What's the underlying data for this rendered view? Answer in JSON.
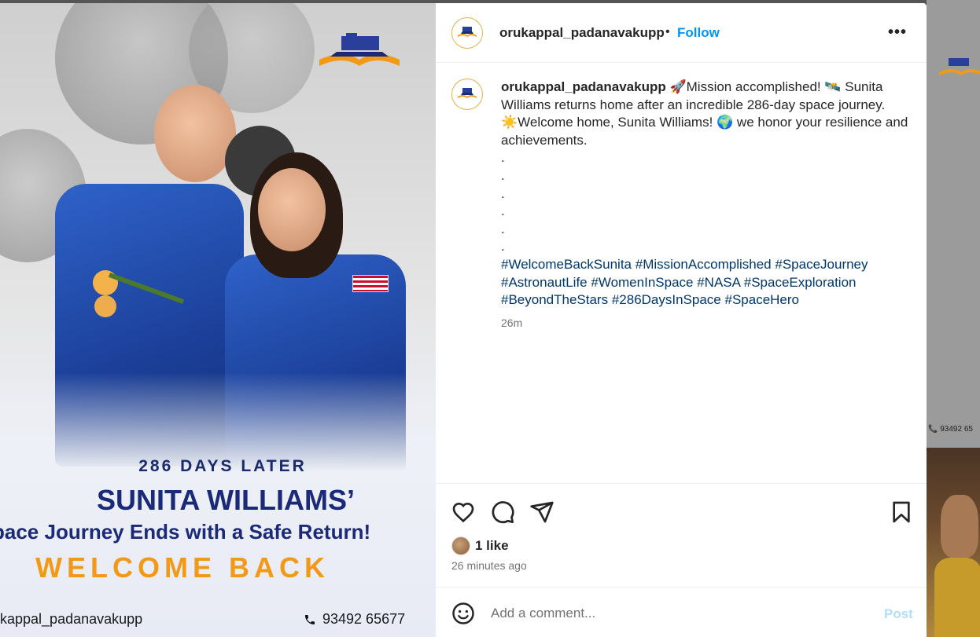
{
  "post": {
    "username": "orukappal_padanavakupp",
    "follow_label": "Follow",
    "separator": "•",
    "more_label": "•••",
    "caption": {
      "username": "orukappal_padanavakupp",
      "line1": "🚀Mission accomplished! 🛰️ Sunita Williams returns home after an incredible 286-day space journey.",
      "line2": "☀️Welcome home, Sunita Williams! 🌍 we honor your resilience and achievements.",
      "dots": [
        ".",
        ".",
        ".",
        ".",
        ".",
        "."
      ],
      "hashtags": [
        "#WelcomeBackSunita",
        "#MissionAccomplished",
        "#SpaceJourney",
        "#AstronautLife",
        "#WomenInSpace",
        "#NASA",
        "#SpaceExploration",
        "#BeyondTheStars",
        "#286DaysInSpace",
        "#SpaceHero"
      ],
      "time": "26m"
    },
    "likes": "1 like",
    "posted_ago": "26 minutes ago",
    "comment": {
      "placeholder": "Add a comment...",
      "post_label": "Post"
    }
  },
  "image": {
    "line1": "286 DAYS LATER",
    "line2": "SUNITA WILLIAMS’",
    "line3": "pace Journey Ends with a Safe Return!",
    "line4": "WELCOME BACK",
    "handle": "kappal_padanavakupp",
    "phone": "93492 65677"
  },
  "background": {
    "phone": "93492 65"
  },
  "colors": {
    "follow": "#0095f6",
    "hashtag": "#00376b",
    "accent": "#f29a17",
    "navy": "#1b2a78"
  }
}
